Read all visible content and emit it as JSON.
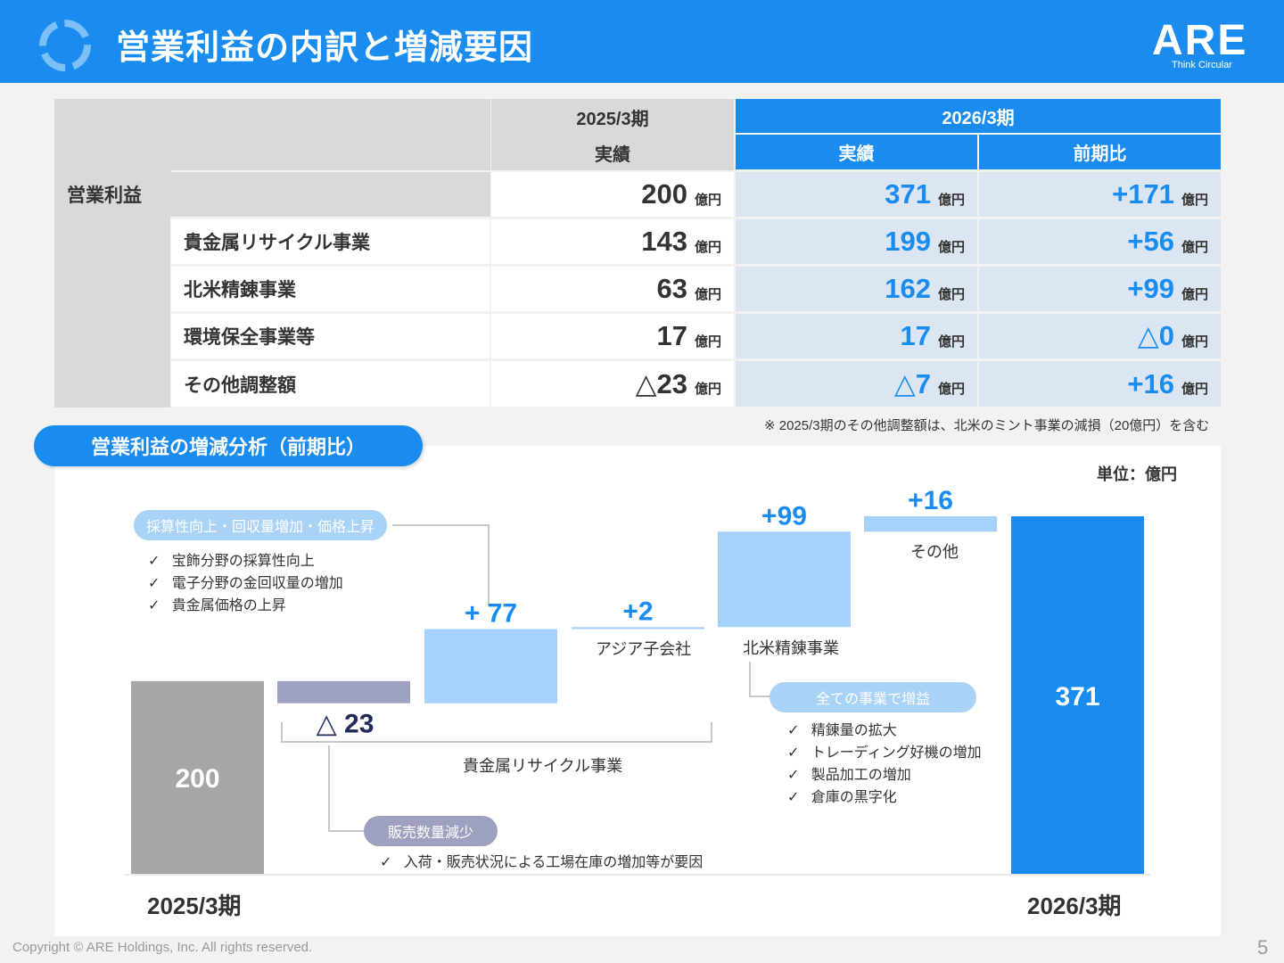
{
  "header": {
    "title": "営業利益の内訳と増減要因",
    "logo": "ARE",
    "logo_tagline": "Think Circular"
  },
  "table": {
    "col_prev_period": "2025/3期",
    "col_curr_period": "2026/3期",
    "col_actual": "実績",
    "col_yoy": "前期比",
    "unit": "億円",
    "rows": [
      {
        "label": "営業利益",
        "prev": "200",
        "curr": "371",
        "yoy": "+171"
      },
      {
        "label": "貴金属リサイクル事業",
        "prev": "143",
        "curr": "199",
        "yoy": "+56"
      },
      {
        "label": "北米精錬事業",
        "prev": "63",
        "curr": "162",
        "yoy": "+99"
      },
      {
        "label": "環境保全事業等",
        "prev": "17",
        "curr": "17",
        "yoy": "△0"
      },
      {
        "label": "その他調整額",
        "prev": "△23",
        "curr": "△7",
        "yoy": "+16"
      }
    ],
    "note": "※ 2025/3期のその他調整額は、北米のミント事業の減損（20億円）を含む"
  },
  "analysis": {
    "title": "営業利益の増減分析（前期比）",
    "unit_label": "単位：億円",
    "callout_top": {
      "title": "採算性向上・回収量増加・価格上昇",
      "items": [
        "宝飾分野の採算性向上",
        "電子分野の金回収量の増加",
        "貴金属価格の上昇"
      ]
    },
    "callout_bottom": {
      "title": "販売数量減少",
      "items": [
        "入荷・販売状況による工場在庫の増加等が要因"
      ]
    },
    "callout_right": {
      "title": "全ての事業で増益",
      "items": [
        "精錬量の拡大",
        "トレーディング好機の増加",
        "製品加工の増加",
        "倉庫の黒字化"
      ]
    },
    "group_label_recycle": "貴金属リサイクル事業",
    "check_mark": "✓"
  },
  "chart_data": {
    "type": "bar",
    "subtype": "waterfall",
    "categories": [
      "2025/3期",
      "",
      "",
      "アジア子会社",
      "北米精錬事業",
      "その他",
      "2026/3期"
    ],
    "steps": [
      {
        "label": "2025/3期",
        "kind": "total",
        "value": 200,
        "display": "200",
        "color": "#a6a6a6"
      },
      {
        "label": "",
        "kind": "delta",
        "value": -23,
        "display": "△ 23",
        "color": "#9ea0c0"
      },
      {
        "label": "",
        "kind": "delta",
        "value": 77,
        "display": "+ 77",
        "color": "#a6d1fb"
      },
      {
        "label": "アジア子会社",
        "kind": "delta",
        "value": 2,
        "display": "+2",
        "color": "#a6d1fb"
      },
      {
        "label": "北米精錬事業",
        "kind": "delta",
        "value": 99,
        "display": "+99",
        "color": "#a6d1fb"
      },
      {
        "label": "その他",
        "kind": "delta",
        "value": 16,
        "display": "+16",
        "color": "#a6d1fb"
      },
      {
        "label": "2026/3期",
        "kind": "total",
        "value": 371,
        "display": "371",
        "color": "#1a8cf0"
      }
    ],
    "ylim": [
      0,
      371
    ]
  },
  "footer": {
    "copyright": "Copyright © ARE Holdings, Inc. All rights reserved.",
    "page": "5"
  }
}
